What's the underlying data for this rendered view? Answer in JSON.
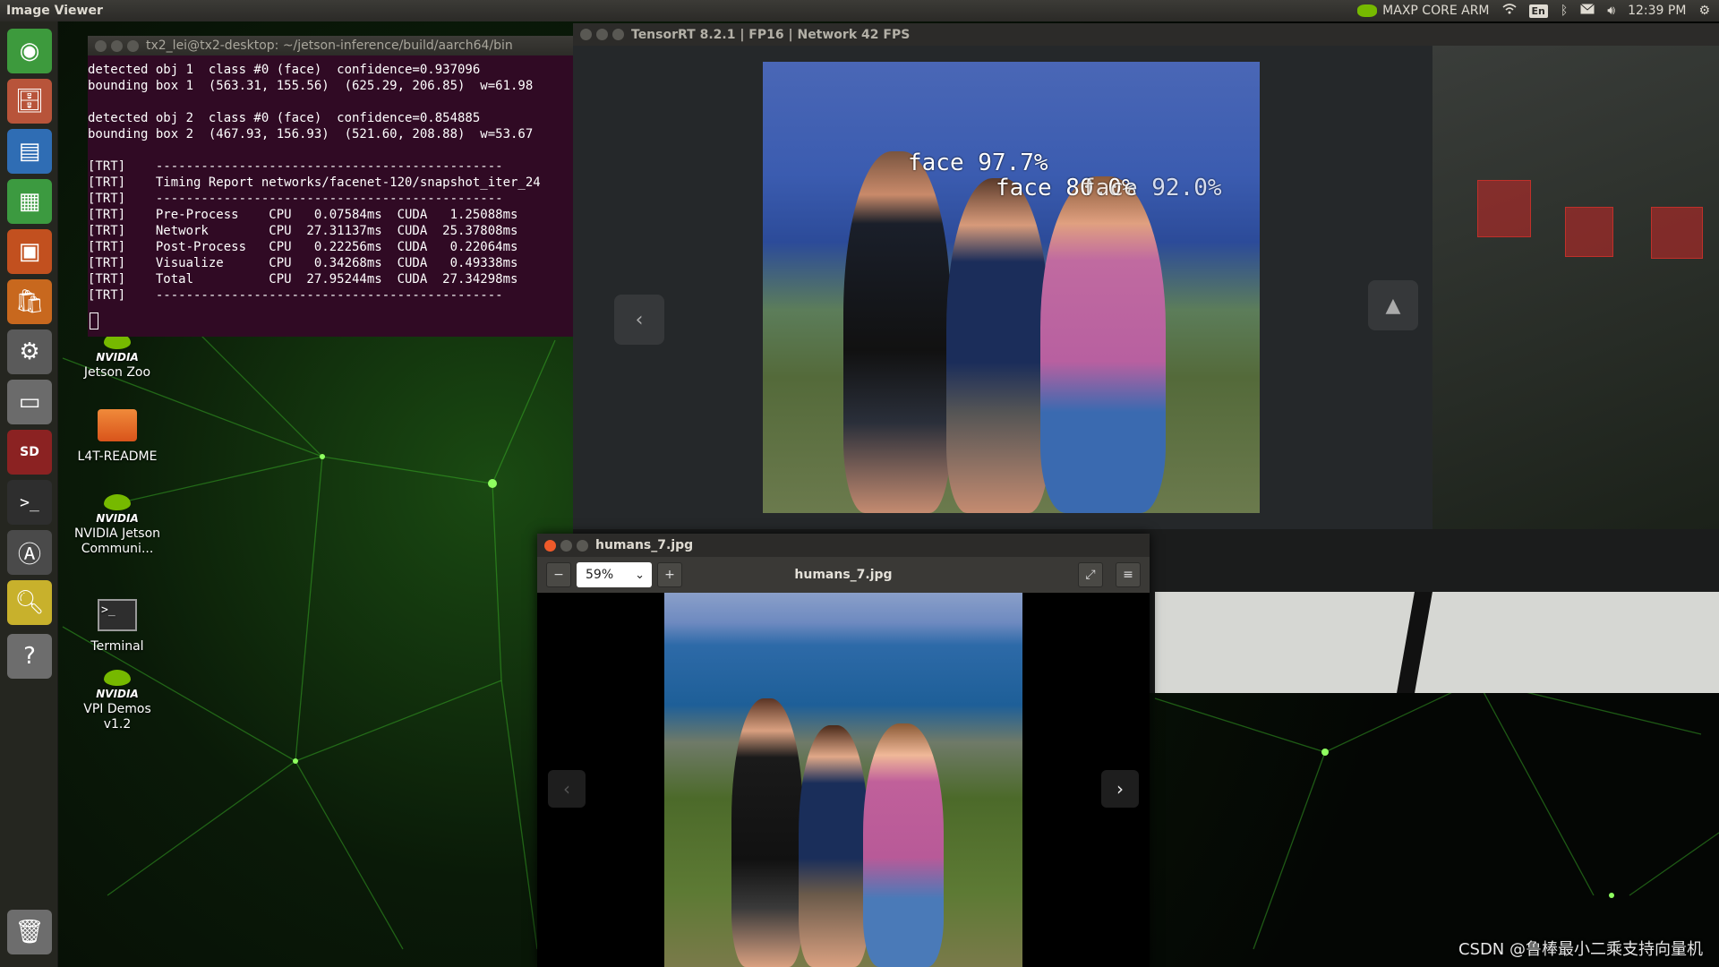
{
  "top_panel": {
    "app_title": "Image Viewer",
    "power_mode": "MAXP CORE ARM",
    "keyboard": "En",
    "clock": "12:39 PM"
  },
  "launcher": {
    "items": [
      {
        "name": "ubuntu-home-icon"
      },
      {
        "name": "file-manager-icon"
      },
      {
        "name": "writer-icon"
      },
      {
        "name": "calc-icon"
      },
      {
        "name": "impress-icon"
      },
      {
        "name": "software-center-icon"
      },
      {
        "name": "system-settings-icon"
      },
      {
        "name": "drive-icon"
      },
      {
        "name": "sd-card-icon"
      },
      {
        "name": "terminal-icon"
      },
      {
        "name": "software-updater-icon"
      },
      {
        "name": "image-viewer-icon"
      },
      {
        "name": "help-icon"
      }
    ],
    "trash": "trash-icon"
  },
  "desktop_icons": [
    {
      "label": "Jetson Zoo",
      "brand": "NVIDIA"
    },
    {
      "label": "L4T-README"
    },
    {
      "label": "NVIDIA Jetson Communi...",
      "brand": "NVIDIA"
    },
    {
      "label": "Terminal"
    },
    {
      "label": "VPI Demos v1.2",
      "brand": "NVIDIA"
    }
  ],
  "terminal": {
    "title": "tx2_lei@tx2-desktop: ~/jetson-inference/build/aarch64/bin",
    "lines": [
      "detected obj 1  class #0 (face)  confidence=0.937096",
      "bounding box 1  (563.31, 155.56)  (625.29, 206.85)  w=61.98",
      "",
      "detected obj 2  class #0 (face)  confidence=0.854885",
      "bounding box 2  (467.93, 156.93)  (521.60, 208.88)  w=53.67",
      "",
      "[TRT]    ----------------------------------------------",
      "[TRT]    Timing Report networks/facenet-120/snapshot_iter_24",
      "[TRT]    ----------------------------------------------",
      "[TRT]    Pre-Process    CPU   0.07584ms  CUDA   1.25088ms",
      "[TRT]    Network        CPU  27.31137ms  CUDA  25.37808ms",
      "[TRT]    Post-Process   CPU   0.22256ms  CUDA   0.22064ms",
      "[TRT]    Visualize      CPU   0.34268ms  CUDA   0.49338ms",
      "[TRT]    Total          CPU  27.95244ms  CUDA  27.34298ms",
      "[TRT]    ----------------------------------------------"
    ]
  },
  "tensorrt": {
    "title": "TensorRT 8.2.1 | FP16 | Network 42 FPS",
    "detections": [
      {
        "label": "face 97.7%"
      },
      {
        "label": "face 80.0%"
      },
      {
        "label": "face 92.0%"
      }
    ]
  },
  "viewer": {
    "title": "humans_7.jpg",
    "zoom": "59%",
    "filename": "humans_7.jpg"
  },
  "watermark": "CSDN @鲁棒最小二乘支持向量机",
  "colors": {
    "terminal_bg": "#300a24",
    "nvidia_green": "#76b900",
    "close_button": "#ef5a2a"
  }
}
